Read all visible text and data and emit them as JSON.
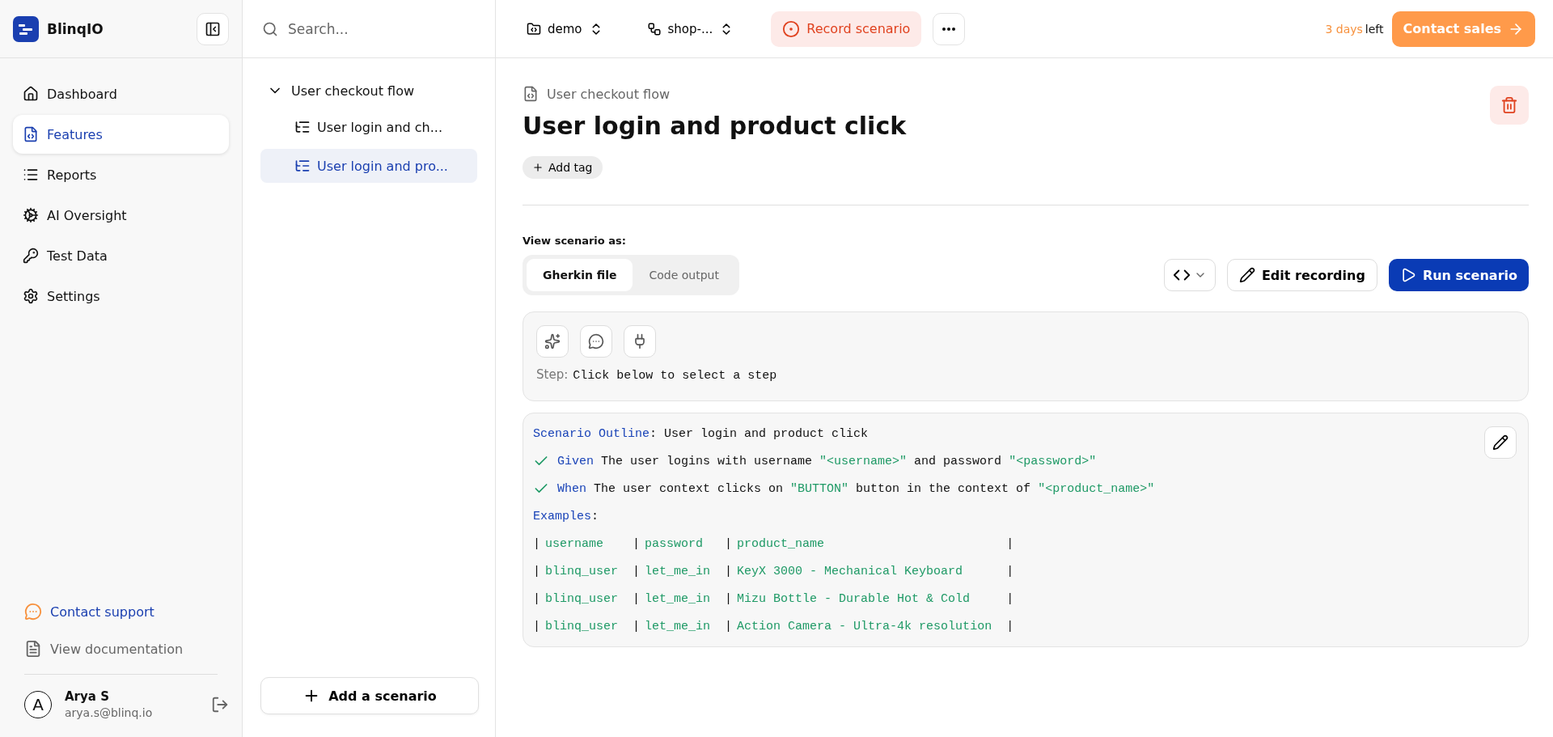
{
  "brand": {
    "name": "BlinqIO"
  },
  "search": {
    "placeholder": "Search..."
  },
  "topbar": {
    "project": "demo",
    "branch": "shop-...",
    "record": "Record scenario",
    "trial_count": "3 days",
    "trial_suffix": "left",
    "contact": "Contact sales"
  },
  "nav": [
    {
      "label": "Dashboard",
      "selected": false
    },
    {
      "label": "Features",
      "selected": true
    },
    {
      "label": "Reports",
      "selected": false
    },
    {
      "label": "AI Oversight",
      "selected": false
    },
    {
      "label": "Test Data",
      "selected": false
    },
    {
      "label": "Settings",
      "selected": false
    }
  ],
  "help_links": [
    {
      "label": "Contact support",
      "kind": "support"
    },
    {
      "label": "View documentation",
      "kind": "docs"
    }
  ],
  "user": {
    "initial": "A",
    "name": "Arya S",
    "email": "arya.s@blinq.io"
  },
  "tree": {
    "label": "User checkout flow",
    "expanded": true,
    "children": [
      {
        "label": "User login and ch...",
        "selected": false
      },
      {
        "label": "User login and pro...",
        "selected": true
      }
    ]
  },
  "add_scenario": "Add a scenario",
  "main": {
    "breadcrumb": "User checkout flow",
    "title": "User login and product click",
    "add_tag": "Add tag",
    "view_label": "View scenario as:",
    "tabs": [
      {
        "label": "Gherkin file",
        "selected": true
      },
      {
        "label": "Code output",
        "selected": false
      }
    ],
    "edit_recording": "Edit recording",
    "run_scenario": "Run scenario",
    "step_label": "Step:",
    "step_value": "Click below to select a step",
    "code": {
      "lines": [
        {
          "kind": "plain",
          "tokens": [
            {
              "kind": "keyword",
              "text": "Scenario Outline"
            },
            {
              "kind": "text",
              "text": ": User login and product click"
            }
          ]
        },
        {
          "kind": "step",
          "passed": true,
          "tokens": [
            {
              "kind": "keyword",
              "text": "Given"
            },
            {
              "kind": "text",
              "text": " The user logins with username "
            },
            {
              "kind": "string",
              "text": "\"<username>\""
            },
            {
              "kind": "text",
              "text": " and password "
            },
            {
              "kind": "string",
              "text": "\"<password>\""
            }
          ]
        },
        {
          "kind": "step",
          "passed": true,
          "tokens": [
            {
              "kind": "keyword",
              "text": "When"
            },
            {
              "kind": "text",
              "text": " The user context clicks on "
            },
            {
              "kind": "string",
              "text": "\"BUTTON\""
            },
            {
              "kind": "text",
              "text": " button in the context of "
            },
            {
              "kind": "string",
              "text": "\"<product_name>\""
            }
          ]
        },
        {
          "kind": "plain",
          "tokens": [
            {
              "kind": "keyword",
              "text": "Examples"
            },
            {
              "kind": "text",
              "text": ":"
            }
          ]
        }
      ],
      "table": {
        "separator": "|",
        "rows": [
          [
            "username",
            "password",
            "product_name"
          ],
          [
            "blinq_user",
            "let_me_in",
            "KeyX 3000 - Mechanical Keyboard"
          ],
          [
            "blinq_user",
            "let_me_in",
            "Mizu Bottle - Durable Hot & Cold"
          ],
          [
            "blinq_user",
            "let_me_in",
            "Action Camera - Ultra-4k resolution"
          ]
        ]
      }
    }
  }
}
